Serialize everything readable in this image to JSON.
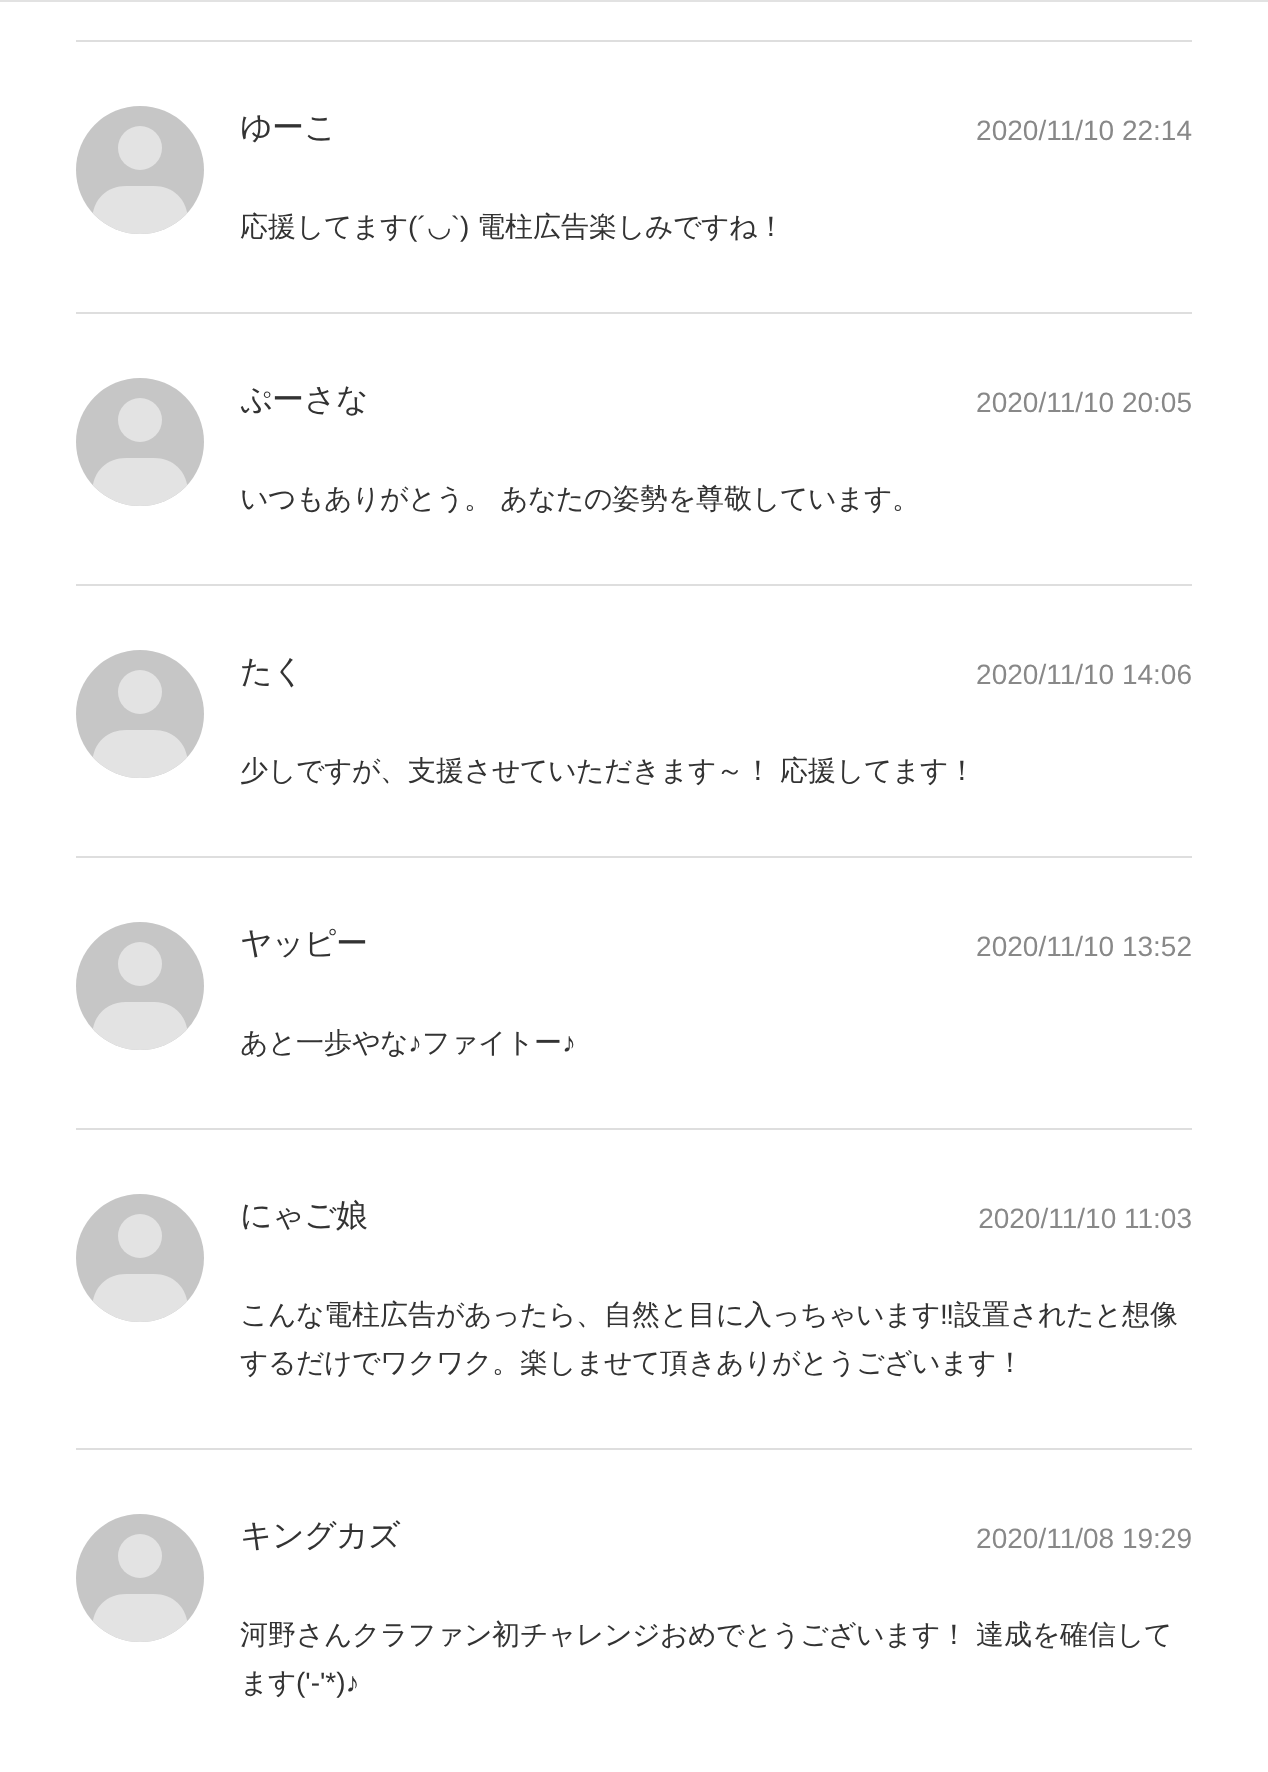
{
  "comments": [
    {
      "name": "ゆーこ",
      "date": "2020/11/10 22:14",
      "text": "応援してます(´◡`) 電柱広告楽しみですね！"
    },
    {
      "name": "ぷーさな",
      "date": "2020/11/10 20:05",
      "text": "いつもありがとう。 あなたの姿勢を尊敬しています。"
    },
    {
      "name": "たく",
      "date": "2020/11/10 14:06",
      "text": "少しですが、支援させていただきます～！ 応援してます！"
    },
    {
      "name": "ヤッピー",
      "date": "2020/11/10 13:52",
      "text": "あと一歩やな♪ファイトー♪"
    },
    {
      "name": "にゃご娘",
      "date": "2020/11/10 11:03",
      "text": "こんな電柱広告があったら、自然と目に入っちゃいます‼設置されたと想像するだけでワクワク。楽しませて頂きありがとうございます！"
    },
    {
      "name": "キングカズ",
      "date": "2020/11/08 19:29",
      "text": "河野さんクラファン初チャレンジおめでとうございます！ 達成を確信してます('-'*)♪"
    }
  ]
}
